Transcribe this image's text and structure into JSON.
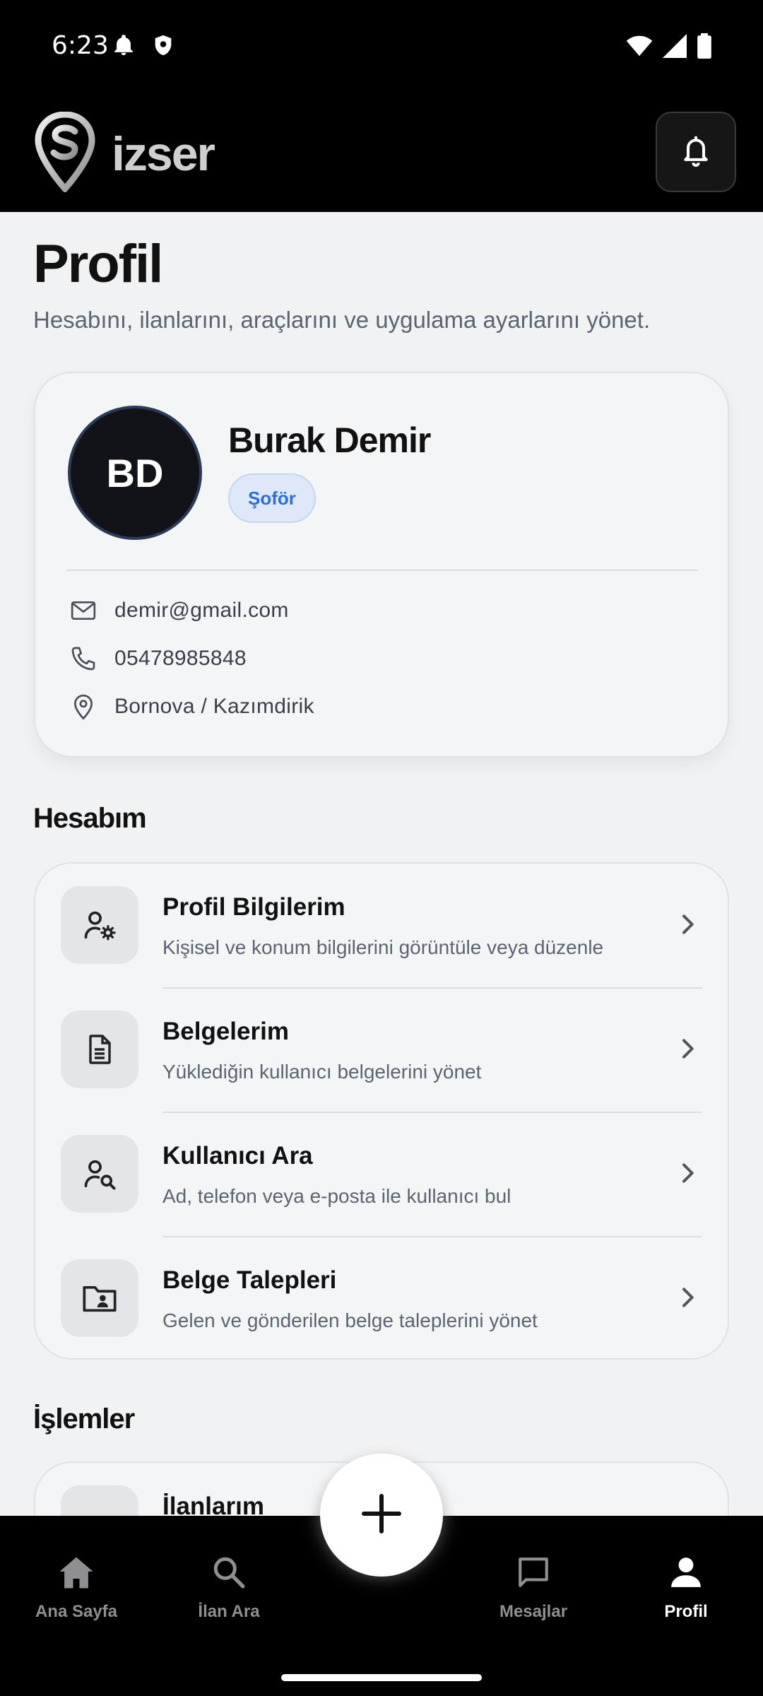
{
  "status_bar": {
    "time": "6:23"
  },
  "header": {
    "app_name": "izser"
  },
  "page": {
    "title": "Profil",
    "subtitle": "Hesabını, ilanlarını, araçlarını ve uygulama ayarlarını yönet."
  },
  "profile": {
    "initials": "BD",
    "name": "Burak Demir",
    "role": "Şoför",
    "email": "demir@gmail.com",
    "phone": "05478985848",
    "location": "Bornova / Kazımdirik"
  },
  "sections": {
    "account": "Hesabım",
    "operations": "İşlemler"
  },
  "account_items": [
    {
      "title": "Profil Bilgilerim",
      "subtitle": "Kişisel ve konum bilgilerini görüntüle veya düzenle",
      "icon": "user-settings-icon"
    },
    {
      "title": "Belgelerim",
      "subtitle": "Yüklediğin kullanıcı belgelerini yönet",
      "icon": "document-icon"
    },
    {
      "title": "Kullanıcı Ara",
      "subtitle": "Ad, telefon veya e-posta ile kullanıcı bul",
      "icon": "user-search-icon"
    },
    {
      "title": "Belge Talepleri",
      "subtitle": "Gelen ve gönderilen belge taleplerini yönet",
      "icon": "folder-user-icon"
    }
  ],
  "operations_items": [
    {
      "title": "İlanlarım"
    }
  ],
  "bottom_nav": [
    {
      "label": "Ana Sayfa",
      "icon": "home-icon"
    },
    {
      "label": "İlan Ara",
      "icon": "search-icon"
    },
    {
      "label": "Mesajlar",
      "icon": "message-icon"
    },
    {
      "label": "Profil",
      "icon": "person-icon",
      "active": true
    }
  ],
  "colors": {
    "accent": "#2f6fd6",
    "bar": "#000000",
    "background": "#f1f2f4"
  }
}
